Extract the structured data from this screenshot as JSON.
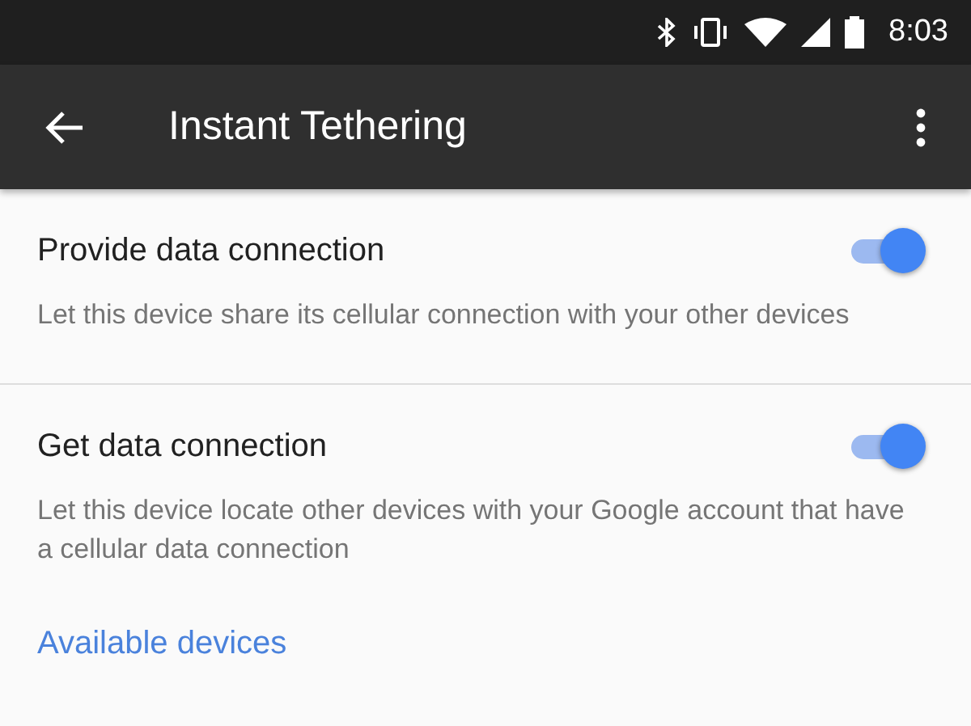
{
  "status_bar": {
    "time": "8:03"
  },
  "app_bar": {
    "title": "Instant Tethering"
  },
  "settings": [
    {
      "title": "Provide data connection",
      "description": "Let this device share its cellular connection with your other devices",
      "on": true
    },
    {
      "title": "Get data connection",
      "description": "Let this device locate other devices with your Google account that have a cellular data connection",
      "on": true
    }
  ],
  "section_header": "Available devices"
}
